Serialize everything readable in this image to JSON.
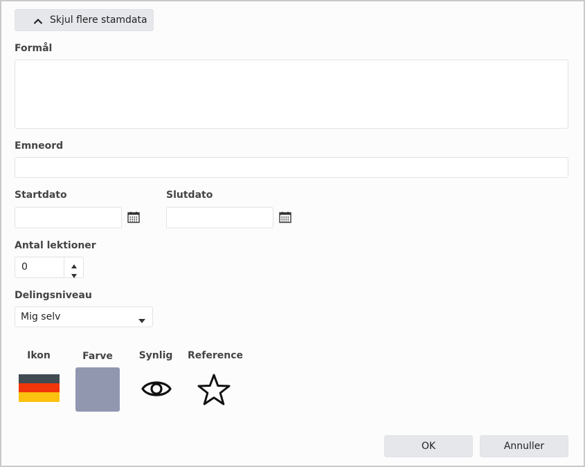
{
  "toggle_button": {
    "label": "Skjul flere stamdata",
    "icon": "chevron-up-icon"
  },
  "fields": {
    "purpose": {
      "label": "Formål",
      "value": ""
    },
    "keywords": {
      "label": "Emneord",
      "value": ""
    },
    "start_date": {
      "label": "Startdato",
      "value": "",
      "icon": "calendar-icon"
    },
    "end_date": {
      "label": "Slutdato",
      "value": "",
      "icon": "calendar-icon"
    },
    "lessons": {
      "label": "Antal lektioner",
      "value": "0"
    },
    "sharing": {
      "label": "Delingsniveau",
      "value": "Mig selv"
    }
  },
  "attributes": {
    "icon": {
      "label": "Ikon",
      "icon": "german-flag-icon"
    },
    "color": {
      "label": "Farve",
      "value": "#9297b0"
    },
    "visible": {
      "label": "Synlig",
      "icon": "eye-icon"
    },
    "reference": {
      "label": "Reference",
      "icon": "star-outline-icon"
    }
  },
  "footer": {
    "ok_label": "OK",
    "cancel_label": "Annuller"
  }
}
